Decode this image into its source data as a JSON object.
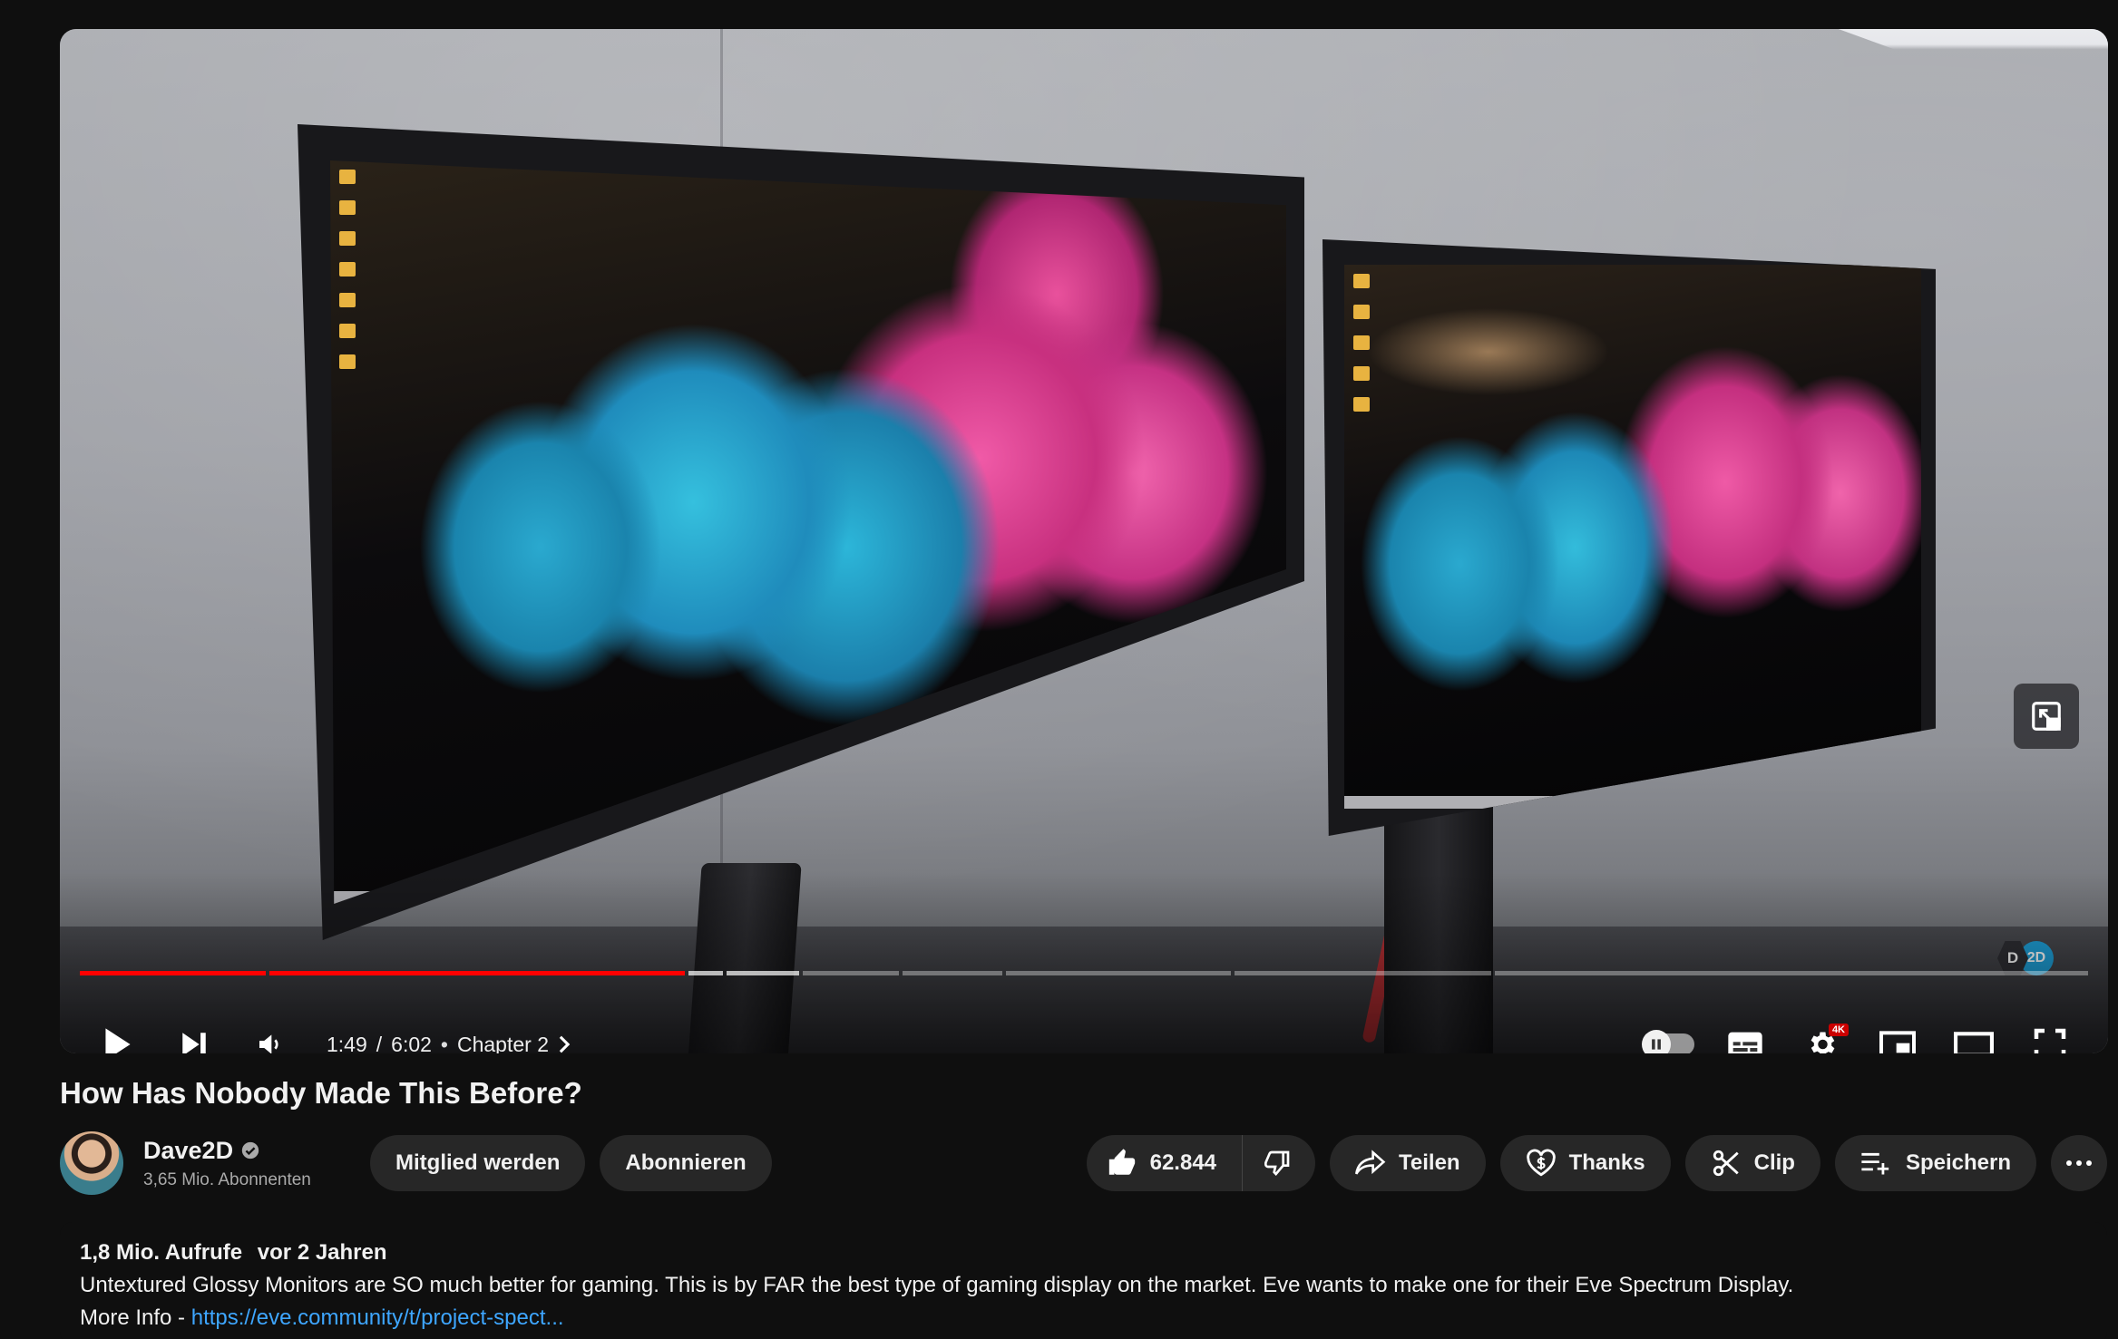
{
  "video": {
    "title": "How Has Nobody Made This Before?",
    "current_time": "1:49",
    "duration": "6:02",
    "time_separator": "/",
    "chapter_label": "Chapter 2",
    "progress_fraction": 0.302,
    "watermark_letter": "D",
    "watermark_badge": "2D",
    "quality_badge": "4K"
  },
  "channel": {
    "name": "Dave2D",
    "subscribers": "3,65 Mio. Abonnenten",
    "join_label": "Mitglied werden",
    "subscribe_label": "Abonnieren"
  },
  "actions": {
    "like_count": "62.844",
    "share_label": "Teilen",
    "thanks_label": "Thanks",
    "clip_label": "Clip",
    "save_label": "Speichern"
  },
  "description": {
    "views": "1,8 Mio. Aufrufe",
    "age": "vor 2 Jahren",
    "text": "Untextured Glossy Monitors are SO much better for gaming. This is by FAR the best type of gaming display on the market. Eve wants to make one for their Eve Spectrum Display.",
    "more_info_prefix": "More Info - ",
    "link": "https://eve.community/t/project-spect..."
  },
  "colors": {
    "progress": "#ff0000",
    "link": "#3ea6ff",
    "pill_bg": "#272727",
    "page_bg": "#0f0f0f"
  }
}
